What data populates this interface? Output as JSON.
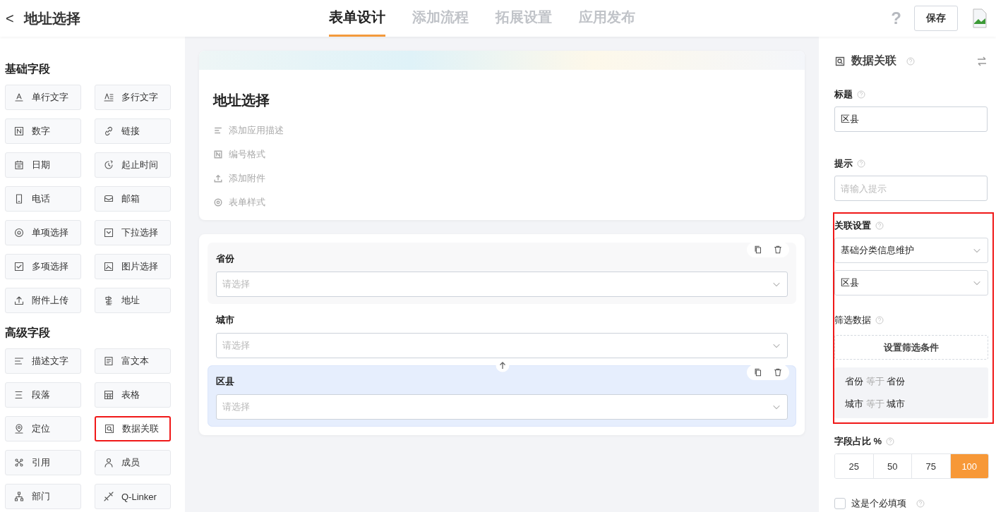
{
  "header": {
    "back": "<",
    "title": "地址选择",
    "tabs": [
      {
        "label": "表单设计",
        "selected": true
      },
      {
        "label": "添加流程",
        "selected": false
      },
      {
        "label": "拓展设置",
        "selected": false
      },
      {
        "label": "应用发布",
        "selected": false
      }
    ],
    "help": "?",
    "save": "保存"
  },
  "palette": [
    {
      "title": "基础字段",
      "items": [
        {
          "label": "单行文字",
          "highlighted": false
        },
        {
          "label": "多行文字",
          "highlighted": false
        },
        {
          "label": "数字",
          "highlighted": false
        },
        {
          "label": "链接",
          "highlighted": false
        },
        {
          "label": "日期",
          "highlighted": false
        },
        {
          "label": "起止时间",
          "highlighted": false
        },
        {
          "label": "电话",
          "highlighted": false
        },
        {
          "label": "邮箱",
          "highlighted": false
        },
        {
          "label": "单项选择",
          "highlighted": false
        },
        {
          "label": "下拉选择",
          "highlighted": false
        },
        {
          "label": "多项选择",
          "highlighted": false
        },
        {
          "label": "图片选择",
          "highlighted": false
        },
        {
          "label": "附件上传",
          "highlighted": false
        },
        {
          "label": "地址",
          "highlighted": false
        }
      ]
    },
    {
      "title": "高级字段",
      "items": [
        {
          "label": "描述文字",
          "highlighted": false
        },
        {
          "label": "富文本",
          "highlighted": false
        },
        {
          "label": "段落",
          "highlighted": false
        },
        {
          "label": "表格",
          "highlighted": false
        },
        {
          "label": "定位",
          "highlighted": false
        },
        {
          "label": "数据关联",
          "highlighted": true
        },
        {
          "label": "引用",
          "highlighted": false
        },
        {
          "label": "成员",
          "highlighted": false
        },
        {
          "label": "部门",
          "highlighted": false
        },
        {
          "label": "Q-Linker",
          "highlighted": false
        }
      ]
    }
  ],
  "form": {
    "title": "地址选择",
    "options": [
      "添加应用描述",
      "编号格式",
      "添加附件",
      "表单样式"
    ],
    "fields": [
      {
        "label": "省份",
        "placeholder": "请选择",
        "hovered": true,
        "selected": false
      },
      {
        "label": "城市",
        "placeholder": "请选择",
        "hovered": false,
        "selected": false
      },
      {
        "label": "区县",
        "placeholder": "请选择",
        "hovered": false,
        "selected": true
      }
    ]
  },
  "properties": {
    "title": "数据关联",
    "title_field": {
      "label": "标题",
      "value": "区县"
    },
    "hint_field": {
      "label": "提示",
      "placeholder": "请输入提示"
    },
    "link_settings": {
      "highlighted": true,
      "label": "关联设置",
      "source": "基础分类信息维护",
      "target": "区县",
      "filter_label": "筛选数据",
      "filter_button": "设置筛选条件",
      "conditions": [
        {
          "field": "省份",
          "operator": "等于",
          "value": "省份"
        },
        {
          "field": "城市",
          "operator": "等于",
          "value": "城市"
        }
      ]
    },
    "width_label": "字段占比 %",
    "widths": [
      {
        "label": "25",
        "selected": false
      },
      {
        "label": "50",
        "selected": false
      },
      {
        "label": "75",
        "selected": false
      },
      {
        "label": "100",
        "selected": true
      }
    ],
    "required": {
      "label": "这是个必填项",
      "checked": false
    }
  }
}
